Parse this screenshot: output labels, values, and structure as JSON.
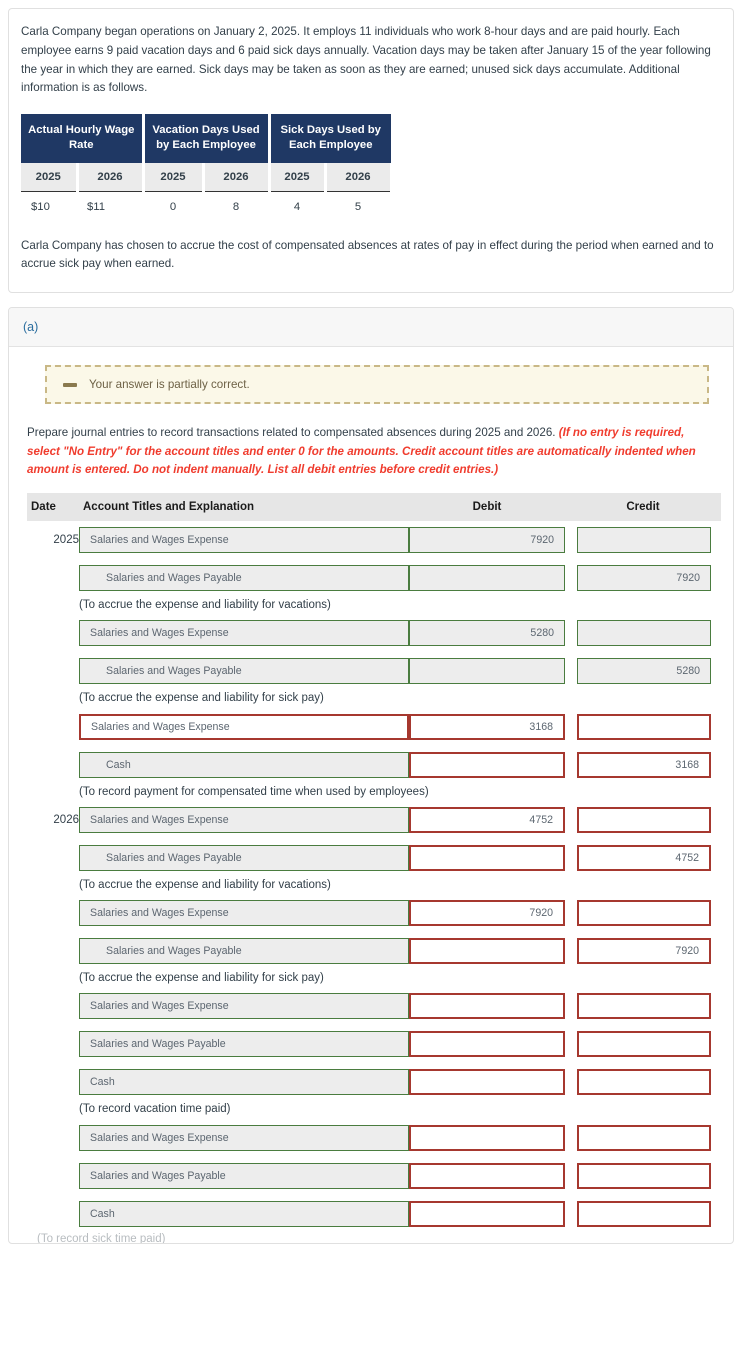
{
  "problem": {
    "intro": "Carla Company began operations on January 2, 2025. It employs 11 individuals who work 8-hour days and are paid hourly. Each employee earns 9 paid vacation days and 6 paid sick days annually. Vacation days may be taken after January 15 of the year following the year in which they are earned. Sick days may be taken as soon as they are earned; unused sick days accumulate. Additional information is as follows.",
    "accrual_note": "Carla Company has chosen to accrue the cost of compensated absences at rates of pay in effect during the period when earned and to accrue sick pay when earned."
  },
  "data_table": {
    "groups": [
      "Actual Hourly Wage Rate",
      "Vacation Days Used by Each Employee",
      "Sick Days Used by Each Employee"
    ],
    "years": [
      "2025",
      "2026",
      "2025",
      "2026",
      "2025",
      "2026"
    ],
    "values": [
      "$10",
      "$11",
      "0",
      "8",
      "4",
      "5"
    ]
  },
  "section": {
    "label": "(a)",
    "alert": {
      "icon": "minus-dash-icon",
      "message": "Your answer is partially correct."
    },
    "instruction_main": "Prepare journal entries to record transactions related to compensated absences during 2025 and 2026.",
    "instruction_required": "(If no entry is required, select \"No Entry\" for the account titles and enter 0 for the amounts. Credit account titles are automatically indented when amount is entered. Do not indent manually. List all debit entries before credit entries.)"
  },
  "journal": {
    "headers": {
      "date": "Date",
      "account": "Account Titles and Explanation",
      "debit": "Debit",
      "credit": "Credit"
    },
    "colors": {
      "correct_border": "#4a7c3f",
      "correct_bg": "#ededed",
      "incorrect_border": "#a6382f",
      "incorrect_bg": "#ffffff",
      "navy": "#1f3864",
      "required_red": "#f03c2e",
      "alert_bg": "#fbf8e8",
      "alert_border": "#c9b886"
    },
    "groups": [
      {
        "date": "2025",
        "rows": [
          {
            "account": "Salaries and Wages Expense",
            "indent": false,
            "acct_state": "correct",
            "debit": "7920",
            "debit_state": "correct",
            "credit": "",
            "credit_state": "correct"
          },
          {
            "account": "Salaries and Wages Payable",
            "indent": true,
            "acct_state": "correct",
            "debit": "",
            "debit_state": "correct",
            "credit": "7920",
            "credit_state": "correct"
          }
        ],
        "memo": "(To accrue the expense and liability for vacations)"
      },
      {
        "date": "",
        "rows": [
          {
            "account": "Salaries and Wages Expense",
            "indent": false,
            "acct_state": "correct",
            "debit": "5280",
            "debit_state": "correct",
            "credit": "",
            "credit_state": "correct"
          },
          {
            "account": "Salaries and Wages Payable",
            "indent": true,
            "acct_state": "correct",
            "debit": "",
            "debit_state": "correct",
            "credit": "5280",
            "credit_state": "correct"
          }
        ],
        "memo": "(To accrue the expense and liability for sick pay)"
      },
      {
        "date": "",
        "rows": [
          {
            "account": "Salaries and Wages Expense",
            "indent": false,
            "acct_state": "incorrect",
            "debit": "3168",
            "debit_state": "incorrect",
            "credit": "",
            "credit_state": "incorrect"
          },
          {
            "account": "Cash",
            "indent": true,
            "acct_state": "correct",
            "debit": "",
            "debit_state": "incorrect",
            "credit": "3168",
            "credit_state": "incorrect"
          }
        ],
        "memo": "(To record payment for compensated time when used by employees)"
      },
      {
        "date": "2026",
        "rows": [
          {
            "account": "Salaries and Wages Expense",
            "indent": false,
            "acct_state": "correct",
            "debit": "4752",
            "debit_state": "incorrect",
            "credit": "",
            "credit_state": "incorrect"
          },
          {
            "account": "Salaries and Wages Payable",
            "indent": true,
            "acct_state": "correct",
            "debit": "",
            "debit_state": "incorrect",
            "credit": "4752",
            "credit_state": "incorrect"
          }
        ],
        "memo": "(To accrue the expense and liability for vacations)"
      },
      {
        "date": "",
        "rows": [
          {
            "account": "Salaries and Wages Expense",
            "indent": false,
            "acct_state": "correct",
            "debit": "7920",
            "debit_state": "incorrect",
            "credit": "",
            "credit_state": "incorrect"
          },
          {
            "account": "Salaries and Wages Payable",
            "indent": true,
            "acct_state": "correct",
            "debit": "",
            "debit_state": "incorrect",
            "credit": "7920",
            "credit_state": "incorrect"
          }
        ],
        "memo": "(To accrue the expense and liability for sick pay)"
      },
      {
        "date": "",
        "rows": [
          {
            "account": "Salaries and Wages Expense",
            "indent": false,
            "acct_state": "correct",
            "debit": "",
            "debit_state": "incorrect",
            "credit": "",
            "credit_state": "incorrect"
          },
          {
            "account": "Salaries and Wages Payable",
            "indent": false,
            "acct_state": "correct",
            "debit": "",
            "debit_state": "incorrect",
            "credit": "",
            "credit_state": "incorrect"
          },
          {
            "account": "Cash",
            "indent": false,
            "acct_state": "correct",
            "debit": "",
            "debit_state": "incorrect",
            "credit": "",
            "credit_state": "incorrect"
          }
        ],
        "memo": "(To record vacation time paid)"
      },
      {
        "date": "",
        "rows": [
          {
            "account": "Salaries and Wages Expense",
            "indent": false,
            "acct_state": "correct",
            "debit": "",
            "debit_state": "incorrect",
            "credit": "",
            "credit_state": "incorrect"
          },
          {
            "account": "Salaries and Wages Payable",
            "indent": false,
            "acct_state": "correct",
            "debit": "",
            "debit_state": "incorrect",
            "credit": "",
            "credit_state": "incorrect"
          },
          {
            "account": "Cash",
            "indent": false,
            "acct_state": "correct",
            "debit": "",
            "debit_state": "incorrect",
            "credit": "",
            "credit_state": "incorrect"
          }
        ],
        "memo": ""
      }
    ]
  }
}
